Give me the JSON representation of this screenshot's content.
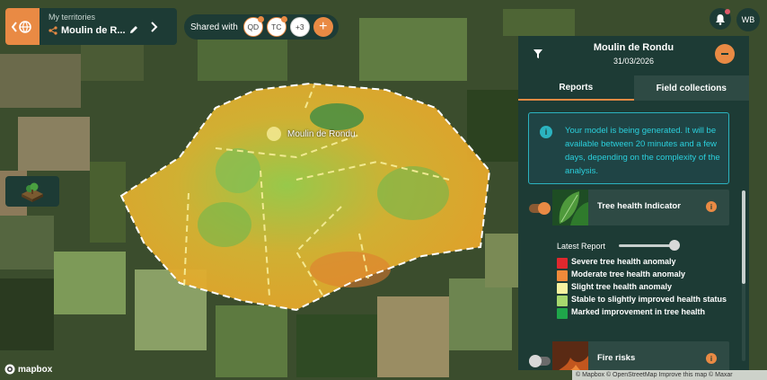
{
  "header": {
    "territories_caption": "My territories",
    "territory_name": "Moulin de R...",
    "shared_with_label": "Shared with",
    "avatars": [
      "QD",
      "TC",
      "+3"
    ]
  },
  "user": {
    "initials": "WB"
  },
  "map": {
    "place_label": "Moulin de Rondu"
  },
  "panel": {
    "title": "Moulin de Rondu",
    "date": "31/03/2026",
    "tabs": [
      {
        "label": "Reports",
        "active": true
      },
      {
        "label": "Field collections",
        "active": false
      }
    ],
    "info_message": "Your model is being generated. It will be available between 20 minutes and a few days, depending on the complexity of the analysis.",
    "layers": [
      {
        "label": "Tree health Indicator",
        "enabled": true
      },
      {
        "label": "Fire risks",
        "enabled": false
      }
    ],
    "latest_report_label": "Latest Report",
    "legend": [
      {
        "label": "Severe tree health anomaly",
        "color": "#e0282e"
      },
      {
        "label": "Moderate tree health anomaly",
        "color": "#f08a3a"
      },
      {
        "label": "Slight tree health anomaly",
        "color": "#f7f2a0"
      },
      {
        "label": "Stable to slightly improved health status",
        "color": "#a6d86e"
      },
      {
        "label": "Marked improvement in tree health",
        "color": "#1fa64a"
      }
    ]
  },
  "footer": {
    "mapbox": "mapbox",
    "attribution": "© Mapbox © OpenStreetMap  Improve this map  © Maxar"
  }
}
